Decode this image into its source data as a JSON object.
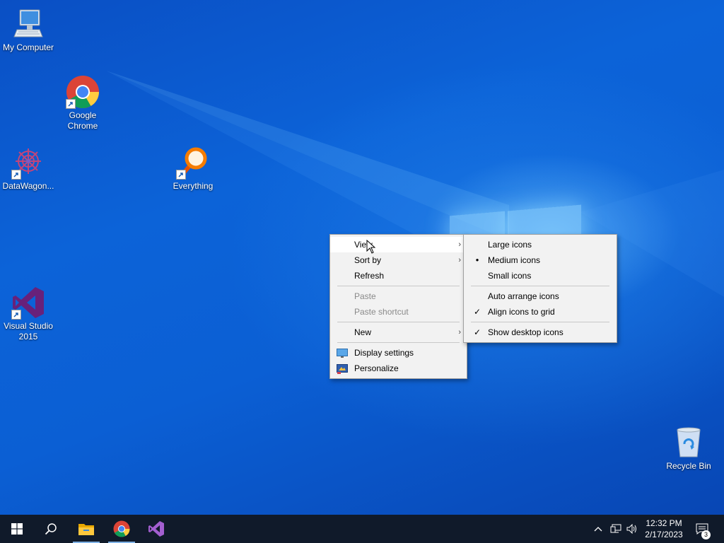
{
  "desktop": {
    "icons": [
      {
        "label": "My Computer"
      },
      {
        "label": "Google Chrome"
      },
      {
        "label": "DataWagon..."
      },
      {
        "label": "Everything"
      },
      {
        "label": "Visual Studio 2015"
      },
      {
        "label": "Recycle Bin"
      }
    ]
  },
  "context_menu": {
    "items": {
      "view": "View",
      "sort_by": "Sort by",
      "refresh": "Refresh",
      "paste": "Paste",
      "paste_shortcut": "Paste shortcut",
      "new": "New",
      "display_settings": "Display settings",
      "personalize": "Personalize"
    },
    "arrow_glyph": "›"
  },
  "view_submenu": {
    "items": {
      "large_icons": "Large icons",
      "medium_icons": "Medium icons",
      "small_icons": "Small icons",
      "auto_arrange": "Auto arrange icons",
      "align_to_grid": "Align icons to grid",
      "show_desktop_icons": "Show desktop icons"
    },
    "selected_size": "Medium icons",
    "checked": [
      "Align icons to grid",
      "Show desktop icons"
    ],
    "bullet_glyph": "●",
    "check_glyph": "✓"
  },
  "taskbar": {
    "pinned": [
      "start-button",
      "search-icon",
      "file-explorer-icon",
      "chrome-icon",
      "visual-studio-icon"
    ],
    "active": [
      "file-explorer-icon",
      "chrome-icon"
    ],
    "tray": [
      "chevron-up-icon",
      "network-icon",
      "volume-icon"
    ],
    "clock": {
      "time": "12:32 PM",
      "date": "2/17/2023"
    },
    "notifications": {
      "count": "3"
    }
  },
  "colors": {
    "desktop_blue": "#0b5fd4",
    "taskbar": "#101a2a",
    "menu_bg": "#f2f2f2",
    "vs_purple": "#68217a",
    "everything_orange": "#f57c00"
  }
}
